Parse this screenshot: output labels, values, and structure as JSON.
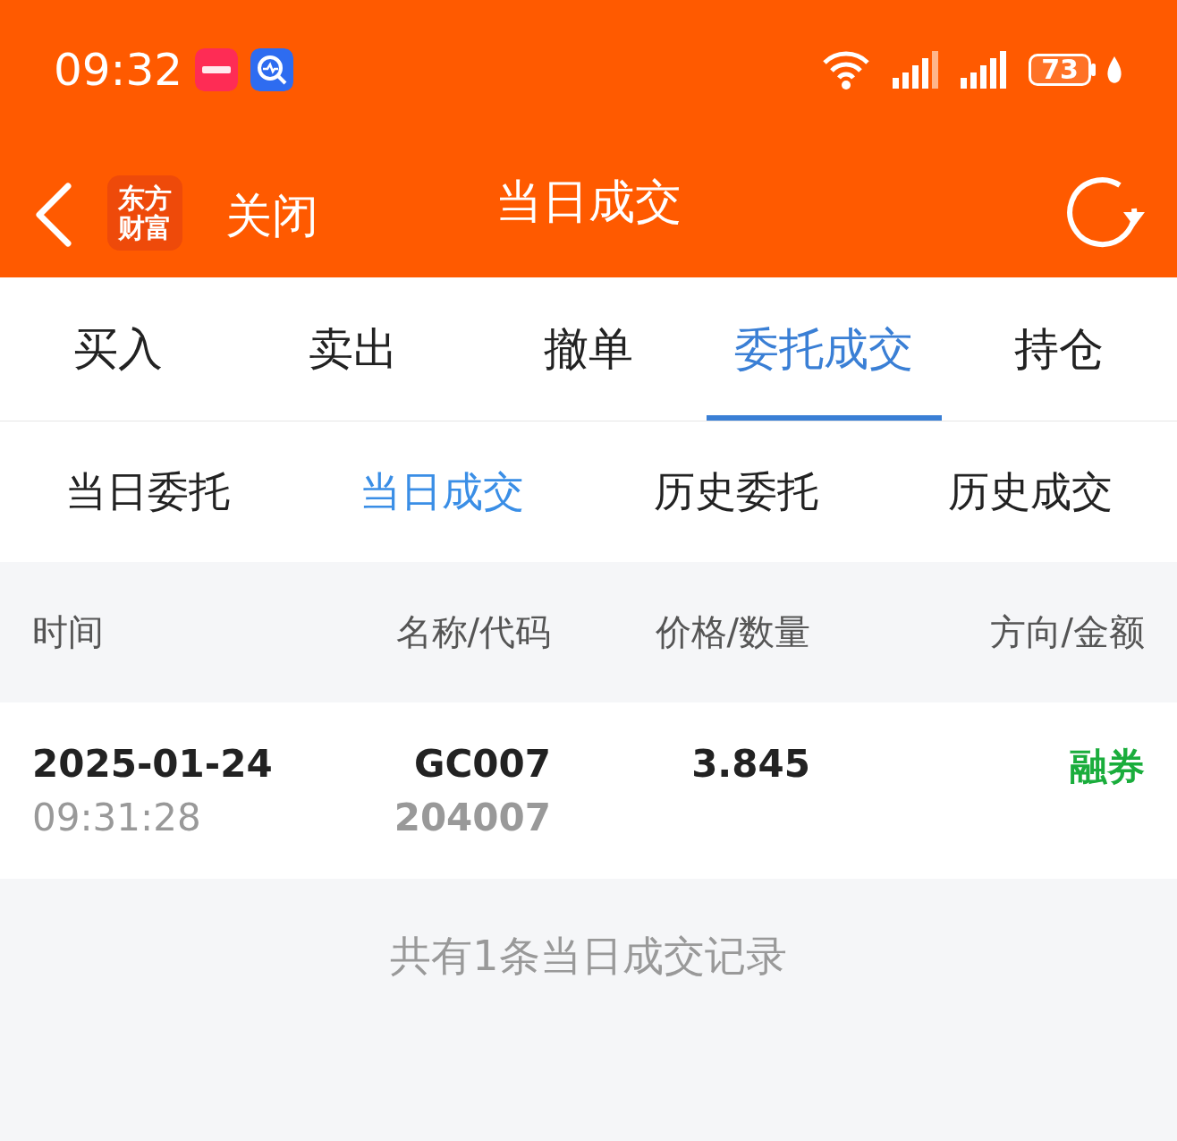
{
  "status_bar": {
    "time": "09:32",
    "battery": "73"
  },
  "header": {
    "logo_text": "东方财富",
    "close_label": "关闭",
    "title": "当日成交"
  },
  "tabs": [
    {
      "label": "买入",
      "selected": false
    },
    {
      "label": "卖出",
      "selected": false
    },
    {
      "label": "撤单",
      "selected": false
    },
    {
      "label": "委托成交",
      "selected": true
    },
    {
      "label": "持仓",
      "selected": false
    }
  ],
  "sub_tabs": [
    {
      "label": "当日委托",
      "selected": false
    },
    {
      "label": "当日成交",
      "selected": true
    },
    {
      "label": "历史委托",
      "selected": false
    },
    {
      "label": "历史成交",
      "selected": false
    }
  ],
  "table": {
    "columns": [
      "时间",
      "名称/代码",
      "价格/数量",
      "方向/金额"
    ],
    "rows": [
      {
        "date": "2025-01-24",
        "time": "09:31:28",
        "name": "GC007",
        "code": "204007",
        "price": "3.845",
        "direction": "融券"
      }
    ]
  },
  "footer_note": "共有1条当日成交记录"
}
